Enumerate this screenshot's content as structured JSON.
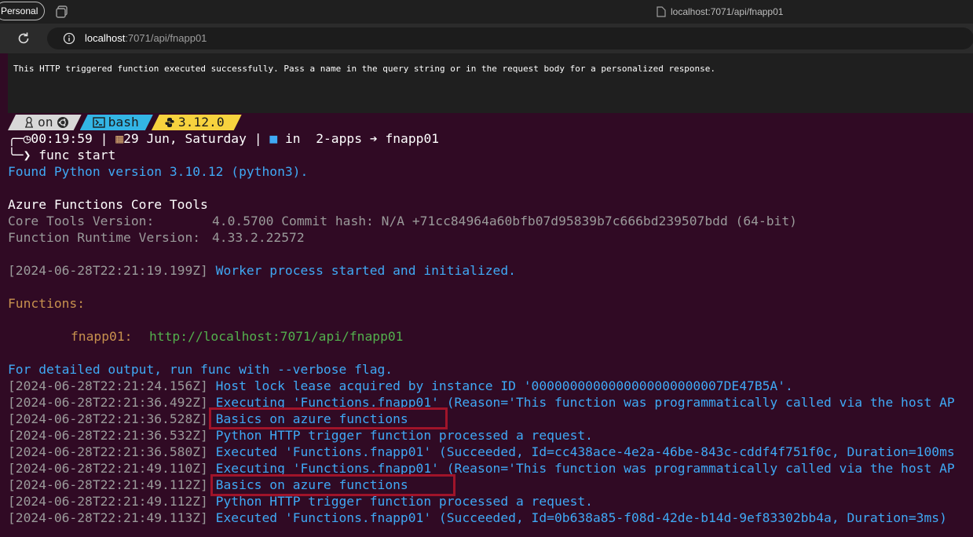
{
  "browser": {
    "profile_label": "Personal",
    "tab_title": "localhost:7071/api/fnapp01",
    "address_host": "localhost",
    "address_path": ":7071/api/fnapp01",
    "page_message": "This HTTP triggered function executed successfully. Pass a name in the query string or in the request body for a personalized response."
  },
  "prompt": {
    "os_label": "on",
    "shell": "bash",
    "python_version": "3.12.0",
    "time": "00:19:59",
    "date": "29 Jun, Saturday",
    "in_label": "in",
    "dir_parent": "2-apps",
    "dir_current": "fnapp01",
    "command": "func start"
  },
  "terminal": {
    "found_python": "Found Python version 3.10.12 (python3).",
    "title": "Azure Functions Core Tools",
    "core_tools_label": "Core Tools Version:",
    "core_tools_value": "4.0.5700 Commit hash: N/A +71cc84964a60bfb07d95839b7c666bd239507bdd (64-bit)",
    "runtime_label": "Function Runtime Version:",
    "runtime_value": "4.33.2.22572",
    "worker_ts": "[2024-06-28T22:21:19.199Z]",
    "worker_msg": "Worker process started and initialized.",
    "functions_label": "Functions:",
    "fn_name": "fnapp01:",
    "fn_url": "http://localhost:7071/api/fnapp01",
    "verbose_hint": "For detailed output, run func with --verbose flag.",
    "log": [
      {
        "ts": "[2024-06-28T22:21:24.156Z]",
        "msg": "Host lock lease acquired by instance ID '0000000000000000000000007DE47B5A'."
      },
      {
        "ts": "[2024-06-28T22:21:36.492Z]",
        "msg": "Executing 'Functions.fnapp01' (Reason='This function was programmatically called via the host AP"
      },
      {
        "ts": "[2024-06-28T22:21:36.528Z]",
        "msg": "Basics on azure functions"
      },
      {
        "ts": "[2024-06-28T22:21:36.532Z]",
        "msg": "Python HTTP trigger function processed a request."
      },
      {
        "ts": "[2024-06-28T22:21:36.580Z]",
        "msg": "Executed 'Functions.fnapp01' (Succeeded, Id=cc438ace-4e2a-46be-843c-cddf4f751f0c, Duration=100ms"
      },
      {
        "ts": "[2024-06-28T22:21:49.110Z]",
        "msg": "Executing 'Functions.fnapp01' (Reason='This function was programmatically called via the host AP"
      },
      {
        "ts": "[2024-06-28T22:21:49.112Z]",
        "msg": "Basics on azure functions"
      },
      {
        "ts": "[2024-06-28T22:21:49.112Z]",
        "msg": "Python HTTP trigger function processed a request."
      },
      {
        "ts": "[2024-06-28T22:21:49.113Z]",
        "msg": "Executed 'Functions.fnapp01' (Succeeded, Id=0b638a85-f08d-42de-b14d-9ef83302bb4a, Duration=3ms)"
      }
    ]
  },
  "colors": {
    "terminal_bg": "#300a24",
    "info_blue": "#3fa9f5",
    "highlight_red": "#a0142a",
    "prompt_python_yellow": "#f7d23e",
    "prompt_bash_cyan": "#33b5e5"
  }
}
